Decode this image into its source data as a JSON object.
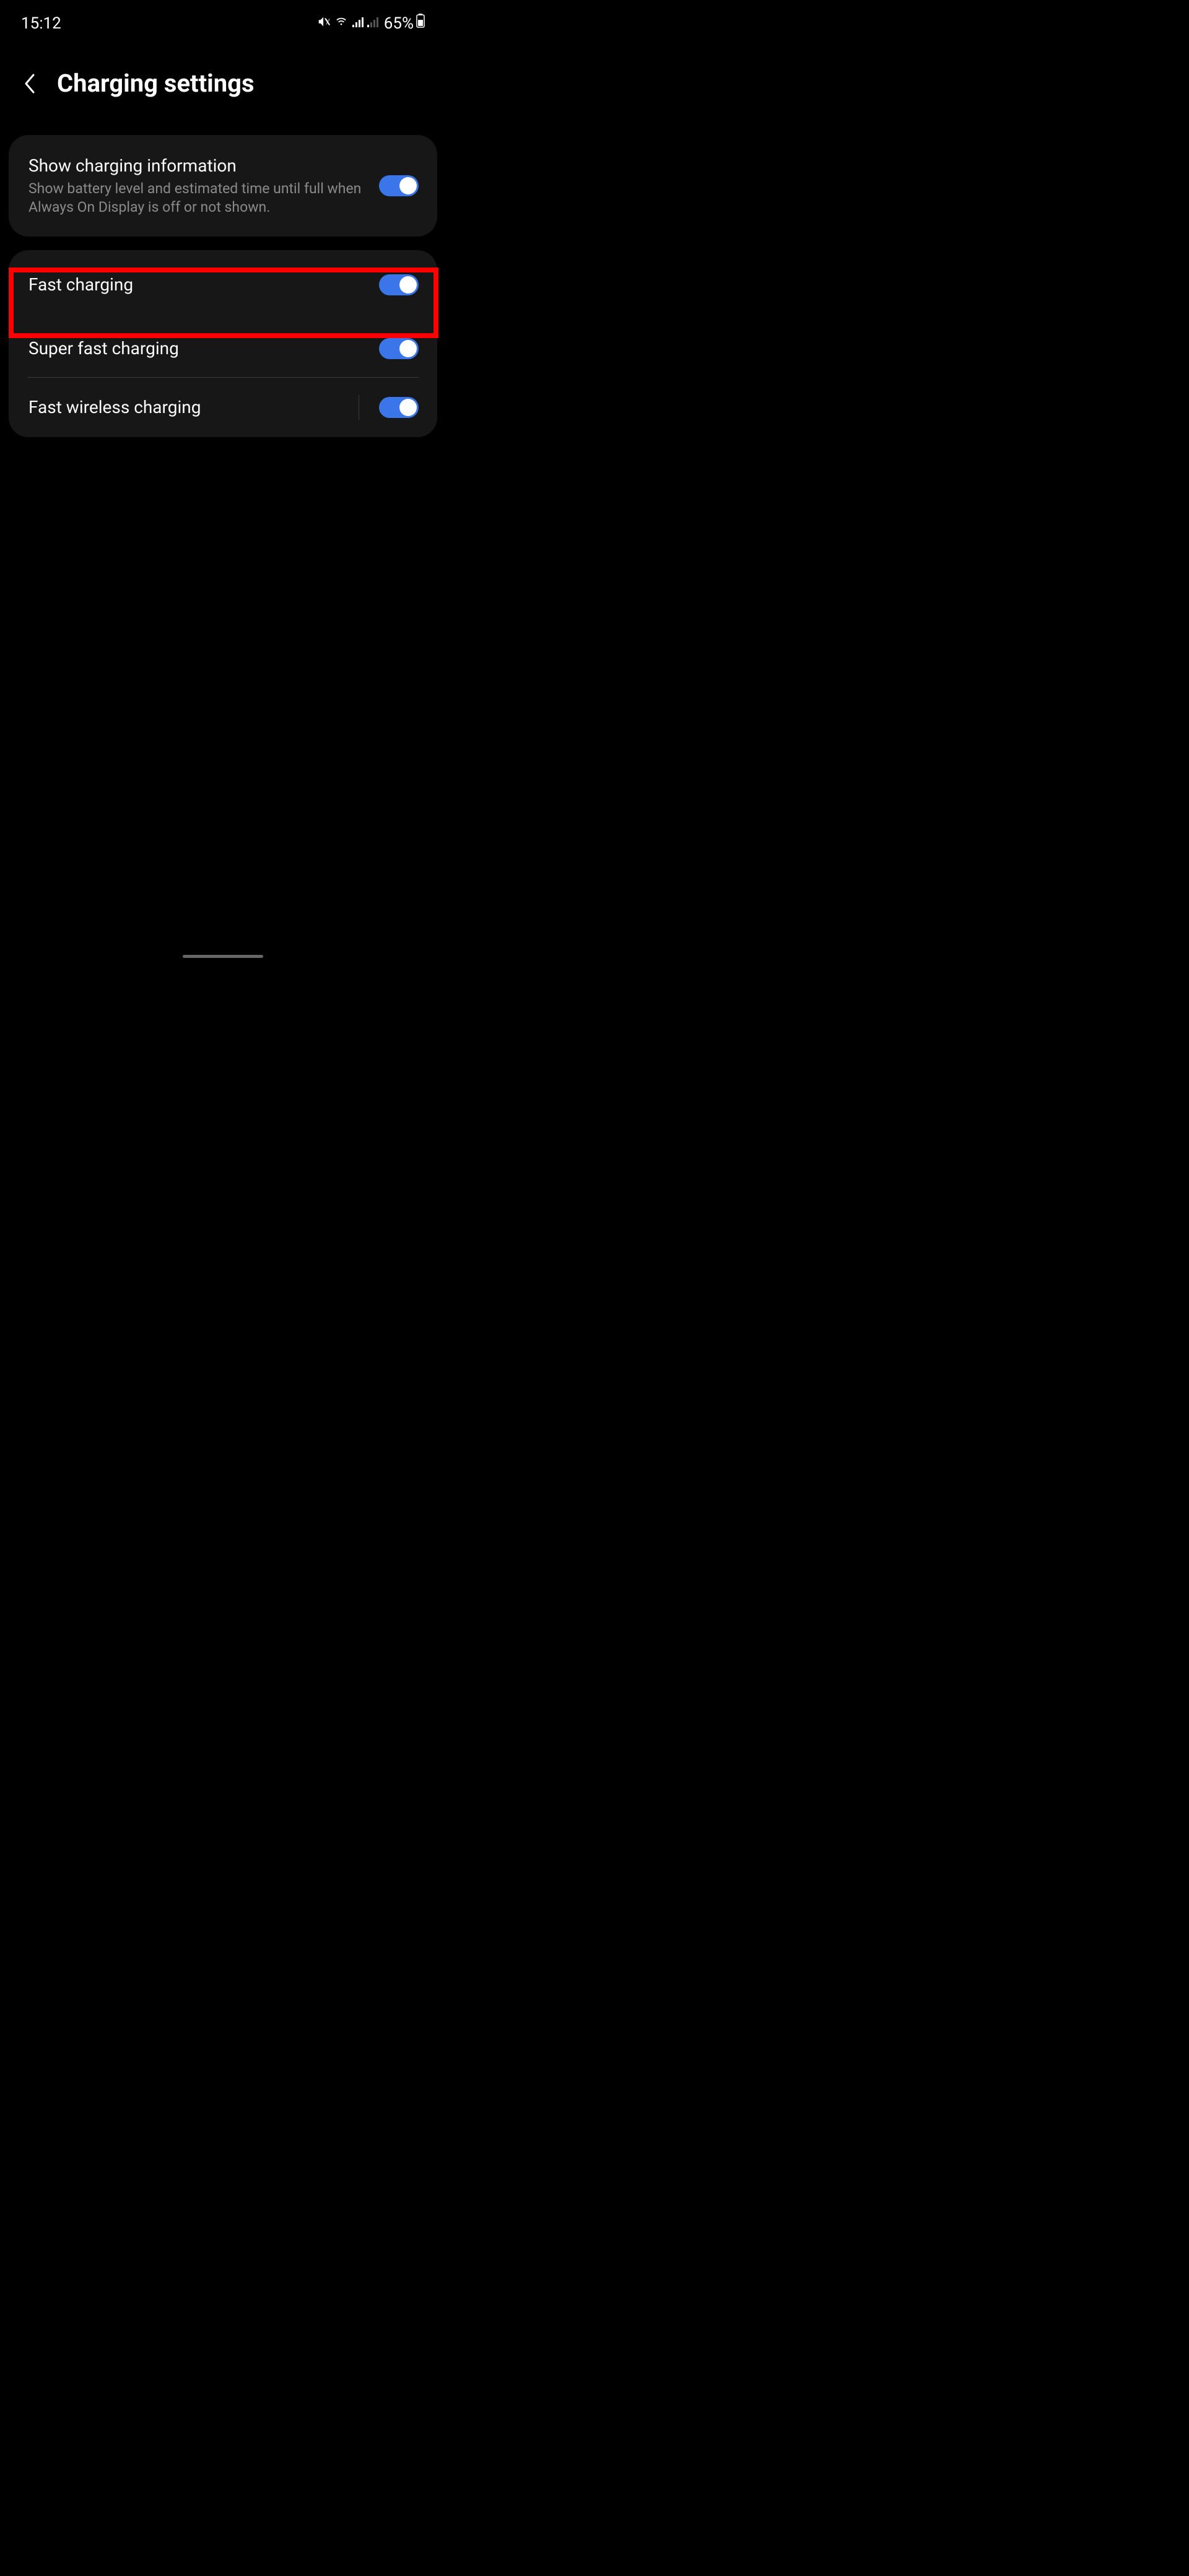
{
  "statusBar": {
    "time": "15:12",
    "battery": "65%"
  },
  "header": {
    "title": "Charging settings"
  },
  "card1": {
    "item1": {
      "title": "Show charging information",
      "subtitle": "Show battery level and estimated time until full when Always On Display is off or not shown.",
      "toggle": true
    }
  },
  "card2": {
    "item1": {
      "title": "Fast charging",
      "toggle": true
    },
    "item2": {
      "title": "Super fast charging",
      "toggle": true
    },
    "item3": {
      "title": "Fast wireless charging",
      "toggle": true
    }
  },
  "highlight": {
    "target": "fast-charging-row"
  }
}
